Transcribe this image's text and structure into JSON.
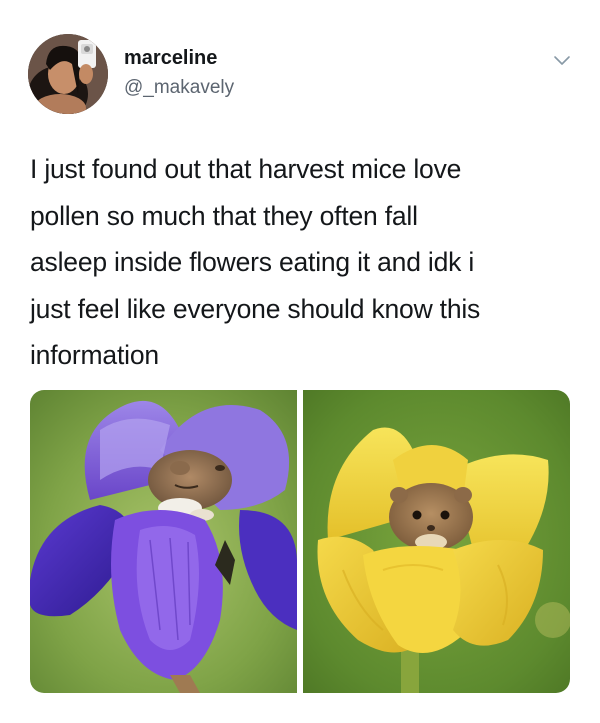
{
  "user": {
    "display_name": "marceline",
    "handle": "@_makavely"
  },
  "tweet": {
    "lines": [
      "I just found out that harvest mice love",
      "pollen so much that they often fall",
      "asleep inside flowers eating it and idk i",
      "just feel like everyone should know this",
      "information"
    ]
  },
  "icons": {
    "menu": "chevron-down-icon"
  },
  "media": {
    "photos": [
      {
        "subject": "harvest mouse asleep in a purple iris"
      },
      {
        "subject": "harvest mouse inside a yellow tulip"
      }
    ]
  },
  "colors": {
    "text": "#14171a",
    "secondary_text": "#5c6570",
    "iris_purple": "#7b4fd6",
    "tulip_yellow": "#f2d43a",
    "background_green": "#6f9a3c"
  }
}
